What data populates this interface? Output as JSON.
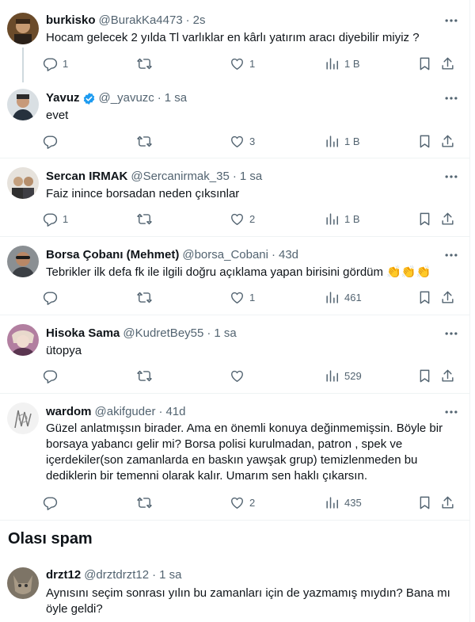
{
  "tweets": [
    {
      "name": "burkisko",
      "handle": "@BurakKa4473",
      "time": "2s",
      "verified": false,
      "text": "Hocam gelecek 2 yılda Tl varlıklar en kârlı yatırım aracı diyebilir miyiz ?",
      "reply_count": "1",
      "retweet_count": "",
      "like_count": "1",
      "view_count": "1 B"
    },
    {
      "name": "Yavuz",
      "handle": "@_yavuzc",
      "time": "1 sa",
      "verified": true,
      "text": "evet",
      "reply_count": "",
      "retweet_count": "",
      "like_count": "3",
      "view_count": "1 B"
    },
    {
      "name": "Sercan IRMAK",
      "handle": "@Sercanirmak_35",
      "time": "1 sa",
      "verified": false,
      "text": "Faiz inince borsadan neden çıksınlar",
      "reply_count": "1",
      "retweet_count": "",
      "like_count": "2",
      "view_count": "1 B"
    },
    {
      "name": "Borsa Çobanı (Mehmet)",
      "handle": "@borsa_Cobani",
      "time": "43d",
      "verified": false,
      "text": "Tebrikler ilk defa fk ile ilgili doğru açıklama yapan birisini gördüm",
      "emoji": "👏👏👏",
      "reply_count": "",
      "retweet_count": "",
      "like_count": "1",
      "view_count": "461"
    },
    {
      "name": "Hisoka Sama",
      "handle": "@KudretBey55",
      "time": "1 sa",
      "verified": false,
      "text": "ütopya",
      "reply_count": "",
      "retweet_count": "",
      "like_count": "",
      "view_count": "529"
    },
    {
      "name": "wardom",
      "handle": "@akifguder",
      "time": "41d",
      "verified": false,
      "text": "Güzel anlatmışsın birader. Ama en önemli konuya değinmemişsin. Böyle bir borsaya yabancı gelir mi? Borsa polisi kurulmadan, patron , spek ve içerdekiler(son zamanlarda en baskın yawşak grup) temizlenmeden bu dediklerin bir temenni olarak kalır. Umarım sen haklı çıkarsın.",
      "reply_count": "",
      "retweet_count": "",
      "like_count": "2",
      "view_count": "435"
    }
  ],
  "spam_section": {
    "title": "Olası spam",
    "tweet": {
      "name": "drzt12",
      "handle": "@drztdrzt12",
      "time": "1 sa",
      "text": "Aynısını seçim sonrası yılın bu zamanları için de yazmamış mıydın? Bana mı öyle geldi?"
    }
  },
  "colors": {
    "text_primary": "#0f1419",
    "text_secondary": "#536471",
    "border": "#eff3f4",
    "verified_blue": "#1d9bf0",
    "thread_line": "#cfd9de"
  },
  "icons": {
    "more": "more-horizontal-icon",
    "reply": "reply-bubble-icon",
    "retweet": "retweet-icon",
    "like": "heart-icon",
    "views": "views-bar-chart-icon",
    "bookmark": "bookmark-icon",
    "share": "share-icon"
  }
}
